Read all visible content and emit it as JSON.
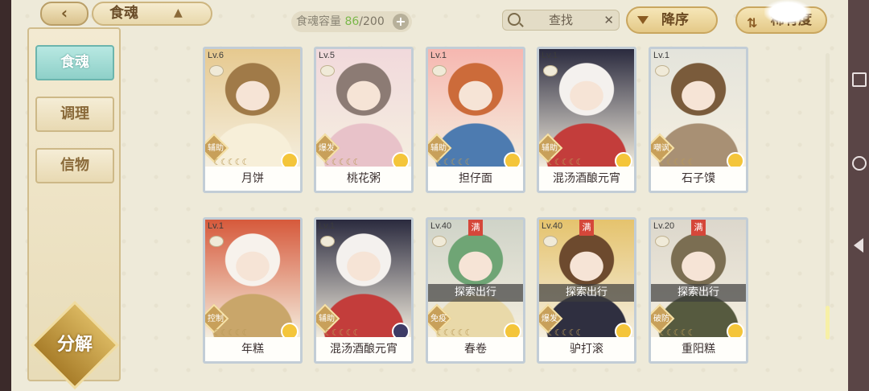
{
  "header": {
    "tab_label": "食魂",
    "capacity_label": "食魂容量",
    "capacity_current": "86",
    "capacity_max": "/200",
    "search_label": "查找",
    "sort_desc_label": "降序",
    "sort_rarity_label": "稀有度"
  },
  "sidebar": {
    "items": [
      {
        "label": "食魂"
      },
      {
        "label": "调理"
      },
      {
        "label": "信物"
      }
    ],
    "decompose_label": "分解"
  },
  "cards": [
    {
      "level": "Lv.6",
      "role": "辅助",
      "name": "月饼",
      "colors": [
        "#e6c98f",
        "#a07a48",
        "#f7efd9"
      ],
      "flower": "yellow"
    },
    {
      "level": "Lv.5",
      "role": "爆发",
      "name": "桃花粥",
      "colors": [
        "#f1d9dc",
        "#8c7b74",
        "#e8c2c9"
      ],
      "flower": "yellow"
    },
    {
      "level": "Lv.1",
      "role": "辅助",
      "name": "担仔面",
      "colors": [
        "#f6b7b0",
        "#cc6b3a",
        "#4d7bb0"
      ],
      "flower": "yellow"
    },
    {
      "level": "Lv.1",
      "role": "辅助",
      "name": "混汤酒酿元宵",
      "colors": [
        "#2a2a3e",
        "#f4f1ee",
        "#c33d3b"
      ],
      "flower": "yellow"
    },
    {
      "level": "Lv.1",
      "role": "嘲讽",
      "name": "石子馍",
      "colors": [
        "#e4e4dc",
        "#7a5b3b",
        "#a89074"
      ],
      "flower": "yellow"
    },
    {
      "level": "Lv.1",
      "role": "控制",
      "name": "年糕",
      "colors": [
        "#d6593b",
        "#f7f2ec",
        "#c9a66a"
      ],
      "flower": "yellow"
    },
    {
      "level": "Lv.1",
      "role": "辅助",
      "name": "混汤酒酿元宵",
      "colors": [
        "#2a2a3e",
        "#f4f1ee",
        "#c33d3b"
      ],
      "flower": "dark"
    },
    {
      "level": "Lv.40",
      "role": "免疫",
      "name": "春卷",
      "explore": "探索出行",
      "maxed": "满",
      "colors": [
        "#cfd3c8",
        "#6fa575",
        "#e9d9a9"
      ],
      "flower": "yellow"
    },
    {
      "level": "Lv.40",
      "role": "爆发",
      "name": "驴打滚",
      "explore": "探索出行",
      "maxed": "满",
      "colors": [
        "#e5c36d",
        "#6d4a2e",
        "#2f2f40"
      ],
      "flower": "yellow"
    },
    {
      "level": "Lv.20",
      "role": "破防",
      "name": "重阳糕",
      "explore": "探索出行",
      "maxed": "满",
      "colors": [
        "#dcd7cc",
        "#7b6e52",
        "#565a3f"
      ],
      "flower": "yellow"
    }
  ]
}
